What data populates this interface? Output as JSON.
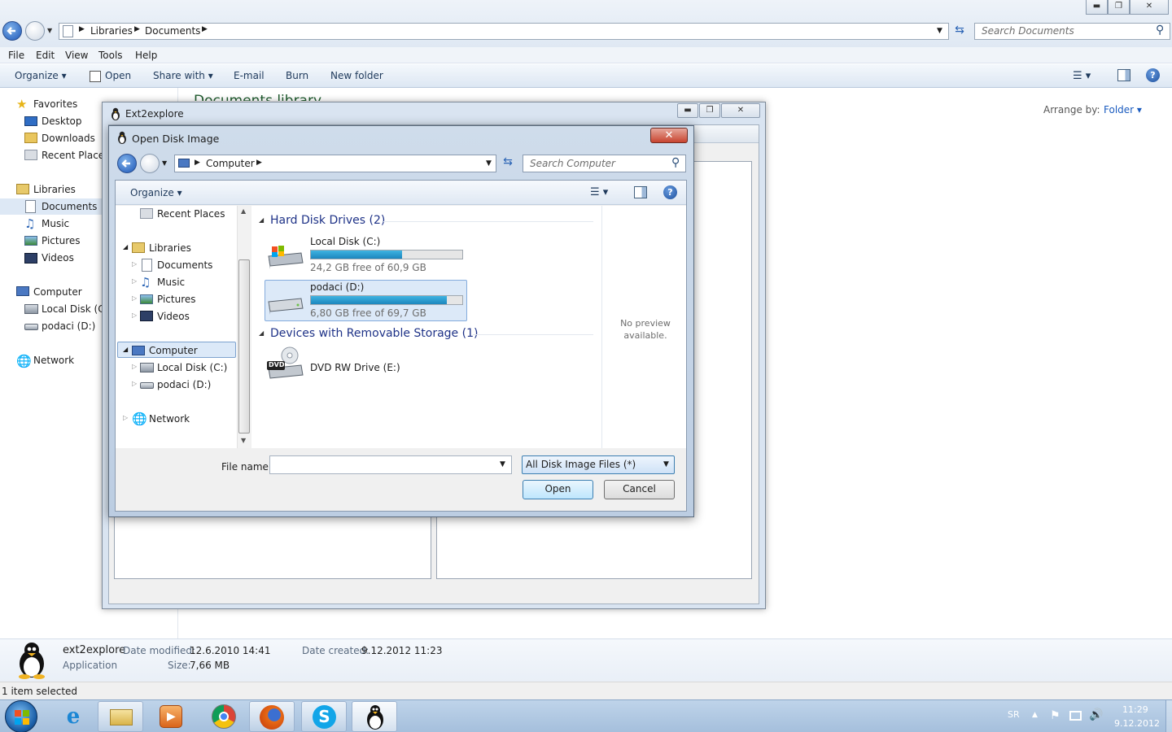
{
  "explorer": {
    "breadcrumb": [
      "Libraries",
      "Documents"
    ],
    "search_placeholder": "Search Documents",
    "menu": [
      "File",
      "Edit",
      "View",
      "Tools",
      "Help"
    ],
    "toolbar": {
      "organize": "Organize",
      "open": "Open",
      "share_with": "Share with",
      "email": "E-mail",
      "burn": "Burn",
      "new_folder": "New folder"
    },
    "library_title": "Documents library",
    "arrange_by_label": "Arrange by:",
    "arrange_by_value": "Folder",
    "nav": {
      "favorites": "Favorites",
      "favorites_items": [
        "Desktop",
        "Downloads",
        "Recent Places"
      ],
      "libraries": "Libraries",
      "libraries_items": [
        "Documents",
        "Music",
        "Pictures",
        "Videos"
      ],
      "computer": "Computer",
      "computer_items": [
        "Local Disk (C:)",
        "podaci (D:)"
      ],
      "network": "Network"
    },
    "details": {
      "name": "ext2explore",
      "type": "Application",
      "modified_label": "Date modified:",
      "modified_value": "12.6.2010 14:41",
      "size_label": "Size:",
      "size_value": "7,66 MB",
      "created_label": "Date created:",
      "created_value": "9.12.2012 11:23"
    },
    "status": "1 item selected"
  },
  "ext2explore": {
    "title": "Ext2explore"
  },
  "dialog": {
    "title": "Open Disk Image",
    "breadcrumb": "Computer",
    "search_placeholder": "Search Computer",
    "organize": "Organize",
    "tree": {
      "recent_places": "Recent Places",
      "libraries": "Libraries",
      "libraries_items": [
        "Documents",
        "Music",
        "Pictures",
        "Videos"
      ],
      "computer": "Computer",
      "computer_items": [
        "Local Disk (C:)",
        "podaci (D:)"
      ],
      "network": "Network"
    },
    "groups": {
      "hard_disks": "Hard Disk Drives (2)",
      "removable": "Devices with Removable Storage (1)"
    },
    "drives": [
      {
        "name": "Local Disk (C:)",
        "free_text": "24,2 GB free of 60,9 GB",
        "used_fraction": 0.6
      },
      {
        "name": "podaci (D:)",
        "free_text": "6,80 GB free of 69,7 GB",
        "used_fraction": 0.9
      }
    ],
    "dvd": {
      "name": "DVD RW Drive (E:)",
      "badge": "DVD"
    },
    "preview_text": "No preview available.",
    "file_name_label": "File name:",
    "file_name_value": "",
    "filter": "All Disk Image Files (*)",
    "open_button": "Open",
    "cancel_button": "Cancel"
  },
  "taskbar": {
    "language": "SR",
    "time": "11:29",
    "date": "9.12.2012"
  }
}
